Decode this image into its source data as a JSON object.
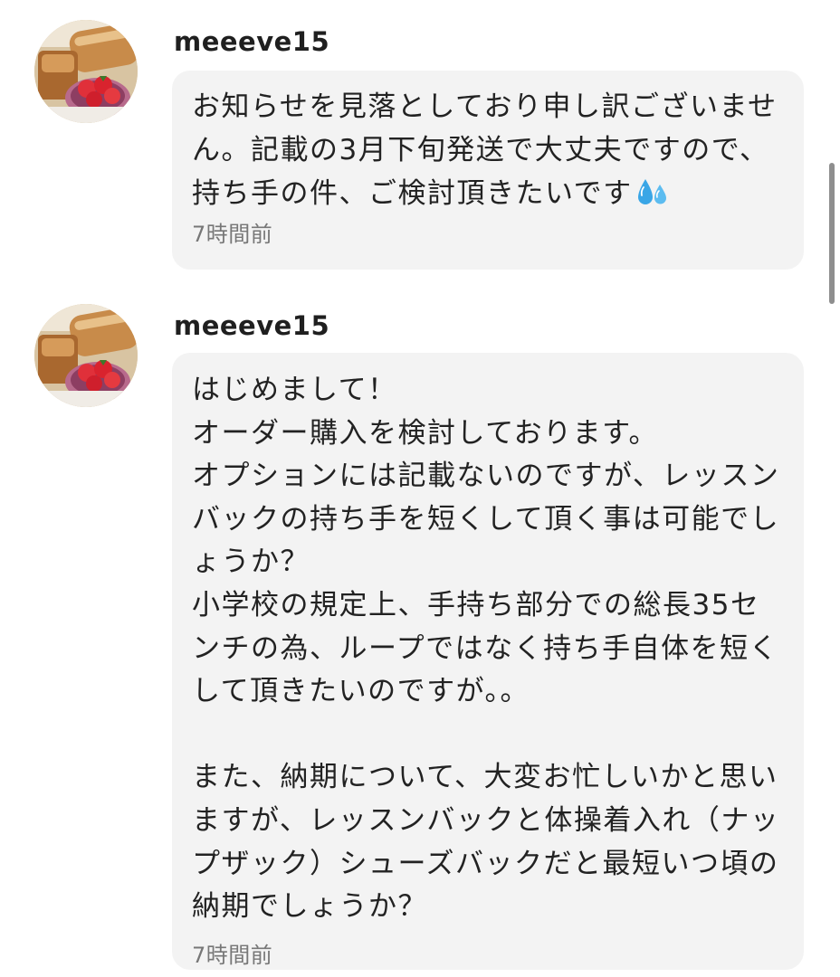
{
  "messages": [
    {
      "username": "meeeve15",
      "avatar_icon": "bread-and-strawberry-photo-avatar",
      "text": "お知らせを見落としており申し訳ございません。記載の3月下旬発送で大丈夫ですので、持ち手の件、ご検討頂きたいです",
      "emoji_icon": "sweat-droplets-icon",
      "time": "7時間前"
    },
    {
      "username": "meeeve15",
      "avatar_icon": "bread-and-strawberry-photo-avatar",
      "text": "はじめまして！\nオーダー購入を検討しております。\nオプションには記載ないのですが、レッスンバックの持ち手を短くして頂く事は可能でしょうか？\n小学校の規定上、手持ち部分での総長35センチの為、ループではなく持ち手自体を短くして頂きたいのですが。。\n\nまた、納期について、大変お忙しいかと思いますが、レッスンバックと体操着入れ（ナップザック）シューズバックだと最短いつ頃の納期でしょうか？",
      "time": "7時間前"
    }
  ],
  "colors": {
    "bubble_bg": "#f3f3f3",
    "text": "#222222",
    "timestamp": "#777777",
    "sweat_emoji": "#3aa6e6"
  }
}
